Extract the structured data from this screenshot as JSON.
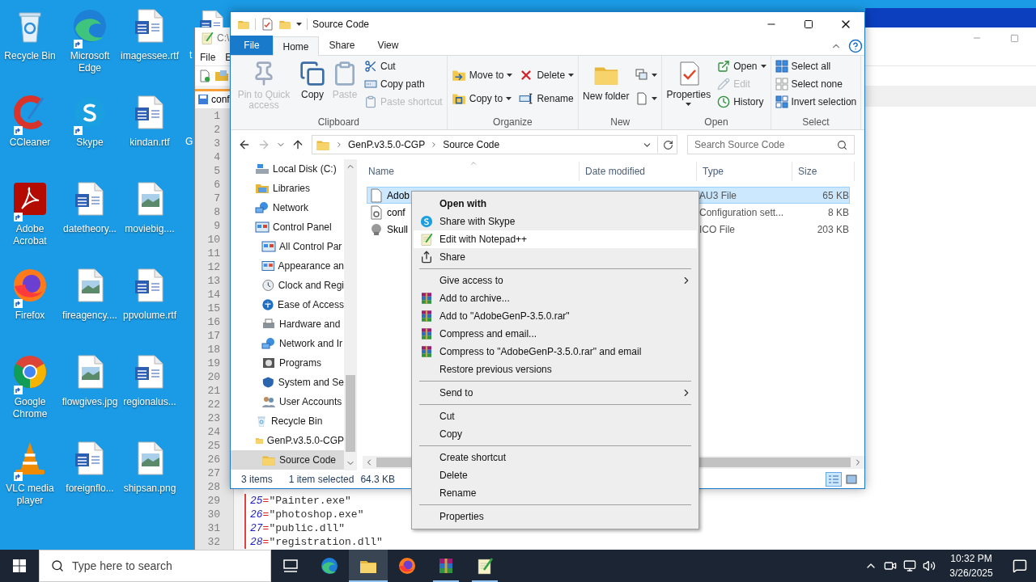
{
  "desktop": {
    "icons": [
      {
        "label": "Recycle Bin",
        "kind": "recycle",
        "shortcut": false
      },
      {
        "label": "Microsoft Edge",
        "kind": "edge",
        "shortcut": true
      },
      {
        "label": "imagessee.rtf",
        "kind": "word",
        "shortcut": false
      },
      {
        "label": "CCleaner",
        "kind": "ccleaner",
        "shortcut": true
      },
      {
        "label": "Skype",
        "kind": "skype",
        "shortcut": true
      },
      {
        "label": "kindan.rtf",
        "kind": "word",
        "shortcut": false
      },
      {
        "label": "Adobe Acrobat",
        "kind": "acrobat",
        "shortcut": true
      },
      {
        "label": "datetheory...",
        "kind": "word",
        "shortcut": false
      },
      {
        "label": "moviebig....",
        "kind": "image",
        "shortcut": false
      },
      {
        "label": "Firefox",
        "kind": "firefox",
        "shortcut": true
      },
      {
        "label": "fireagency....",
        "kind": "image",
        "shortcut": false
      },
      {
        "label": "ppvolume.rtf",
        "kind": "word",
        "shortcut": false
      },
      {
        "label": "Google Chrome",
        "kind": "chrome",
        "shortcut": true
      },
      {
        "label": "flowgives.jpg",
        "kind": "image",
        "shortcut": false
      },
      {
        "label": "regionalus...",
        "kind": "word",
        "shortcut": false
      },
      {
        "label": "VLC media player",
        "kind": "vlc",
        "shortcut": true
      },
      {
        "label": "foreignflo...",
        "kind": "word",
        "shortcut": false
      },
      {
        "label": "shipsan.png",
        "kind": "image",
        "shortcut": false
      }
    ],
    "cut_labels": [
      "t",
      "G"
    ]
  },
  "notepad": {
    "title": "C:\\",
    "menu": [
      "File",
      "E"
    ],
    "tab": "conf",
    "line_numbers": [
      "1",
      "2",
      "3",
      "4",
      "5",
      "6",
      "7",
      "8",
      "9",
      "10",
      "11",
      "12",
      "13",
      "14",
      "15",
      "16",
      "17",
      "18",
      "19",
      "20",
      "21",
      "22",
      "23",
      "24",
      "25",
      "26",
      "27",
      "28",
      "29",
      "30",
      "31",
      "32"
    ],
    "code_lines": [
      {
        "key": "25",
        "op": "=",
        "value": "\"Painter.exe\""
      },
      {
        "key": "26",
        "op": "=",
        "value": "\"photoshop.exe\""
      },
      {
        "key": "27",
        "op": "=",
        "value": "\"public.dll\""
      },
      {
        "key": "28",
        "op": "=",
        "value": "\"registration.dll\""
      }
    ]
  },
  "explorer": {
    "title": "Source Code",
    "ribbon_tabs": [
      {
        "label": "File",
        "kind": "file",
        "selected": false
      },
      {
        "label": "Home",
        "kind": "tab",
        "selected": true
      },
      {
        "label": "Share",
        "kind": "tab",
        "selected": false
      },
      {
        "label": "View",
        "kind": "tab",
        "selected": false
      }
    ],
    "ribbon_groups": [
      {
        "label": "Clipboard",
        "items": [
          {
            "kind": "large",
            "buttons": [
              {
                "label": "Pin to Quick access",
                "kind": "pin",
                "disabled": true,
                "dropdown": false
              }
            ]
          },
          {
            "kind": "large",
            "buttons": [
              {
                "label": "Copy",
                "kind": "copy",
                "disabled": false,
                "dropdown": false
              }
            ]
          },
          {
            "kind": "large",
            "buttons": [
              {
                "label": "Paste",
                "kind": "paste",
                "disabled": true,
                "dropdown": false
              }
            ]
          },
          {
            "kind": "stack",
            "buttons": [
              {
                "label": "Cut",
                "kind": "cut",
                "disabled": false,
                "dropdown": false
              },
              {
                "label": "Copy path",
                "kind": "copy-path",
                "disabled": false,
                "dropdown": false
              },
              {
                "label": "Paste shortcut",
                "kind": "paste-shortcut",
                "disabled": true,
                "dropdown": false
              }
            ]
          }
        ]
      },
      {
        "label": "Organize",
        "items": [
          {
            "kind": "stack",
            "buttons": [
              {
                "label": "Move to",
                "kind": "move",
                "disabled": false,
                "dropdown": true
              },
              {
                "label": "Copy to",
                "kind": "copyto",
                "disabled": false,
                "dropdown": true
              }
            ]
          },
          {
            "kind": "stack",
            "buttons": [
              {
                "label": "Delete",
                "kind": "delete",
                "disabled": false,
                "dropdown": true
              },
              {
                "label": "Rename",
                "kind": "rename",
                "disabled": false,
                "dropdown": false
              }
            ]
          }
        ]
      },
      {
        "label": "New",
        "items": [
          {
            "kind": "large",
            "buttons": [
              {
                "label": "New folder",
                "kind": "new-folder",
                "disabled": false,
                "dropdown": false
              }
            ]
          },
          {
            "kind": "stack",
            "buttons": [
              {
                "kind": "new-item",
                "disabled": false,
                "dropdown": true
              },
              {
                "kind": "easy-access",
                "disabled": false,
                "dropdown": true
              }
            ]
          }
        ]
      },
      {
        "label": "Open",
        "items": [
          {
            "kind": "large",
            "buttons": [
              {
                "label": "Properties",
                "kind": "properties",
                "disabled": false,
                "dropdown": true
              }
            ]
          },
          {
            "kind": "stack",
            "buttons": [
              {
                "label": "Open",
                "kind": "open",
                "disabled": false,
                "dropdown": true
              },
              {
                "label": "Edit",
                "kind": "edit",
                "disabled": true,
                "dropdown": false
              },
              {
                "label": "History",
                "kind": "history",
                "disabled": false,
                "dropdown": false
              }
            ]
          }
        ]
      },
      {
        "label": "Select",
        "items": [
          {
            "kind": "stack",
            "buttons": [
              {
                "label": "Select all",
                "kind": "select-all",
                "disabled": false,
                "dropdown": false
              },
              {
                "label": "Select none",
                "kind": "select-none",
                "disabled": false,
                "dropdown": false
              },
              {
                "label": "Invert selection",
                "kind": "invert",
                "disabled": false,
                "dropdown": false
              }
            ]
          }
        ]
      }
    ],
    "path": [
      "GenP.v3.5.0-CGP",
      "Source Code"
    ],
    "search_placeholder": "Search Source Code",
    "nav": [
      {
        "label": "Local Disk (C:)",
        "kind": "drive",
        "selected": false
      },
      {
        "label": "Libraries",
        "kind": "libraries",
        "selected": false
      },
      {
        "label": "Network",
        "kind": "network",
        "selected": false
      },
      {
        "label": "Control Panel",
        "kind": "control",
        "selected": false,
        "children": [
          {
            "label": "All Control Par",
            "kind": "control",
            "selected": false
          },
          {
            "label": "Appearance an",
            "kind": "control",
            "selected": false
          },
          {
            "label": "Clock and Regi",
            "kind": "clock",
            "selected": false
          },
          {
            "label": "Ease of Access",
            "kind": "access",
            "selected": false
          },
          {
            "label": "Hardware and",
            "kind": "printer",
            "selected": false
          },
          {
            "label": "Network and Ir",
            "kind": "network",
            "selected": false
          },
          {
            "label": "Programs",
            "kind": "programs",
            "selected": false
          },
          {
            "label": "System and Se",
            "kind": "shield",
            "selected": false
          },
          {
            "label": "User Accounts",
            "kind": "users",
            "selected": false
          }
        ]
      },
      {
        "label": "Recycle Bin",
        "kind": "recycle",
        "selected": false
      },
      {
        "label": "GenP.v3.5.0-CGP",
        "kind": "folder",
        "selected": false,
        "children": [
          {
            "label": "Source Code",
            "kind": "folder",
            "selected": true
          }
        ]
      }
    ],
    "columns": [
      "Name",
      "Date modified",
      "Type",
      "Size"
    ],
    "files": [
      {
        "name": "Adob",
        "type": "AU3 File",
        "size": "65 KB",
        "kind": "script",
        "selected": true
      },
      {
        "name": "conf",
        "type": "Configuration sett...",
        "size": "8 KB",
        "kind": "config",
        "selected": false
      },
      {
        "name": "Skull",
        "type": "ICO File",
        "size": "203 KB",
        "kind": "ico",
        "selected": false
      }
    ],
    "status": {
      "count": "3 items",
      "selection": "1 item selected",
      "size": "64.3 KB"
    },
    "views": [
      {
        "kind": "details",
        "selected": true
      },
      {
        "kind": "preview",
        "selected": false
      }
    ]
  },
  "context_menu": [
    {
      "kind": "plain",
      "label": "Open with",
      "bold": true,
      "selected": false,
      "submenu": false
    },
    {
      "kind": "skype",
      "label": "Share with Skype",
      "bold": false,
      "selected": false,
      "submenu": false
    },
    {
      "kind": "notepad",
      "label": "Edit with Notepad++",
      "bold": false,
      "selected": true,
      "submenu": false
    },
    {
      "kind": "share",
      "label": "Share",
      "bold": false,
      "selected": false,
      "submenu": false
    },
    {
      "kind": "separator"
    },
    {
      "kind": "plain",
      "label": "Give access to",
      "bold": false,
      "selected": false,
      "submenu": true
    },
    {
      "kind": "archive",
      "label": "Add to archive...",
      "bold": false,
      "selected": false,
      "submenu": false
    },
    {
      "kind": "archive",
      "label": "Add to \"AdobeGenP-3.5.0.rar\"",
      "bold": false,
      "selected": false,
      "submenu": false
    },
    {
      "kind": "archive",
      "label": "Compress and email...",
      "bold": false,
      "selected": false,
      "submenu": false
    },
    {
      "kind": "archive",
      "label": "Compress to \"AdobeGenP-3.5.0.rar\" and email",
      "bold": false,
      "selected": false,
      "submenu": false
    },
    {
      "kind": "plain",
      "label": "Restore previous versions",
      "bold": false,
      "selected": false,
      "submenu": false
    },
    {
      "kind": "separator"
    },
    {
      "kind": "plain",
      "label": "Send to",
      "bold": false,
      "selected": false,
      "submenu": true
    },
    {
      "kind": "separator"
    },
    {
      "kind": "plain",
      "label": "Cut",
      "bold": false,
      "selected": false,
      "submenu": false
    },
    {
      "kind": "plain",
      "label": "Copy",
      "bold": false,
      "selected": false,
      "submenu": false
    },
    {
      "kind": "separator"
    },
    {
      "kind": "plain",
      "label": "Create shortcut",
      "bold": false,
      "selected": false,
      "submenu": false
    },
    {
      "kind": "plain",
      "label": "Delete",
      "bold": false,
      "selected": false,
      "submenu": false
    },
    {
      "kind": "plain",
      "label": "Rename",
      "bold": false,
      "selected": false,
      "submenu": false
    },
    {
      "kind": "separator"
    },
    {
      "kind": "plain",
      "label": "Properties",
      "bold": false,
      "selected": false,
      "submenu": false
    }
  ],
  "taskbar": {
    "search_placeholder": "Type here to search",
    "apps": [
      {
        "kind": "taskview",
        "active": false,
        "running": false
      },
      {
        "kind": "edge",
        "active": false,
        "running": false
      },
      {
        "kind": "folder",
        "active": true,
        "running": true
      },
      {
        "kind": "firefox",
        "active": false,
        "running": false
      },
      {
        "kind": "winrar",
        "active": false,
        "running": true
      },
      {
        "kind": "notepad",
        "active": false,
        "running": true
      }
    ],
    "time": "10:32 PM",
    "date": "3/26/2025"
  }
}
